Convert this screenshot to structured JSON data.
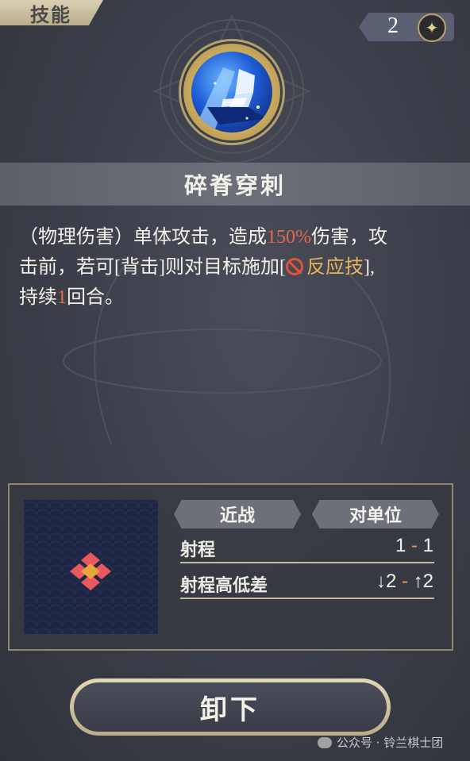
{
  "header": {
    "tab_label": "技能",
    "counter_value": "2",
    "counter_icon": "four-point-star-icon"
  },
  "skill": {
    "icon": "shattered-fist-icon",
    "name": "碎脊穿刺",
    "description": {
      "line1_prefix": "（物理伤害）单体攻击，造成",
      "damage_value": "150%",
      "line1_suffix": "伤害，攻",
      "line2_prefix": "击前，若可[背击]则对目标施加[",
      "status_icon": "prohibited-icon",
      "status_name": "反应技",
      "line2_suffix": "],",
      "line3_prefix": "持续",
      "duration_value": "1",
      "line3_suffix": "回合。"
    }
  },
  "stats": {
    "attack_type": "近战",
    "target_type": "对单位",
    "range_label": "射程",
    "range_min": "1",
    "range_sep": "-",
    "range_max": "1",
    "height_label": "射程高低差",
    "height_down": "↓2",
    "height_sep": "-",
    "height_up": "↑2"
  },
  "area_grid": {
    "pattern": "diamond-cross",
    "center_color": "#e8a53a",
    "tile_color": "#e8585c"
  },
  "actions": {
    "unload_label": "卸下"
  },
  "watermark": {
    "text": "公众号 · 铃兰棋士团"
  },
  "colors": {
    "highlight_red": "#e06a4b",
    "highlight_gold": "#e7b25d",
    "frame_gold": "#b8a56e"
  }
}
